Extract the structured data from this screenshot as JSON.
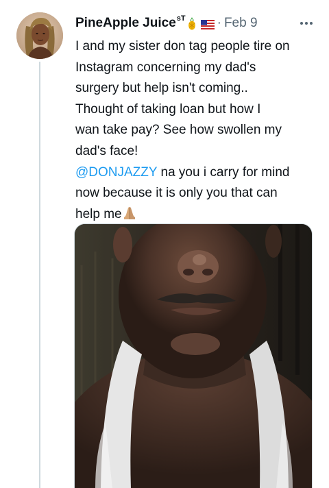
{
  "tweet": {
    "author": {
      "display_name": "PineApple Juice",
      "name_suffix": "sT",
      "emoji_icons": [
        "pineapple-icon",
        "us-flag-icon"
      ]
    },
    "separator": "·",
    "timestamp": "Feb 9",
    "more_icon": "more-horizontal-icon",
    "text_lines": [
      "I and my sister don tag people tire on",
      "Instagram concerning my dad's",
      "surgery but help isn't coming..",
      "Thought of taking loan but  how I",
      "wan take pay? See how swollen my",
      "dad's face!"
    ],
    "mention": "@DONJAZZY",
    "mention_rest": " na you i carry for mind",
    "closing_lines": [
      "now because it is only you that can",
      "help me"
    ],
    "closing_emoji": "folded-hands-icon",
    "media": {
      "type": "photo"
    }
  },
  "colors": {
    "text": "#0f1419",
    "secondary": "#536471",
    "link": "#1d9bf0",
    "thread_line": "#cfd9de",
    "background": "#ffffff"
  }
}
